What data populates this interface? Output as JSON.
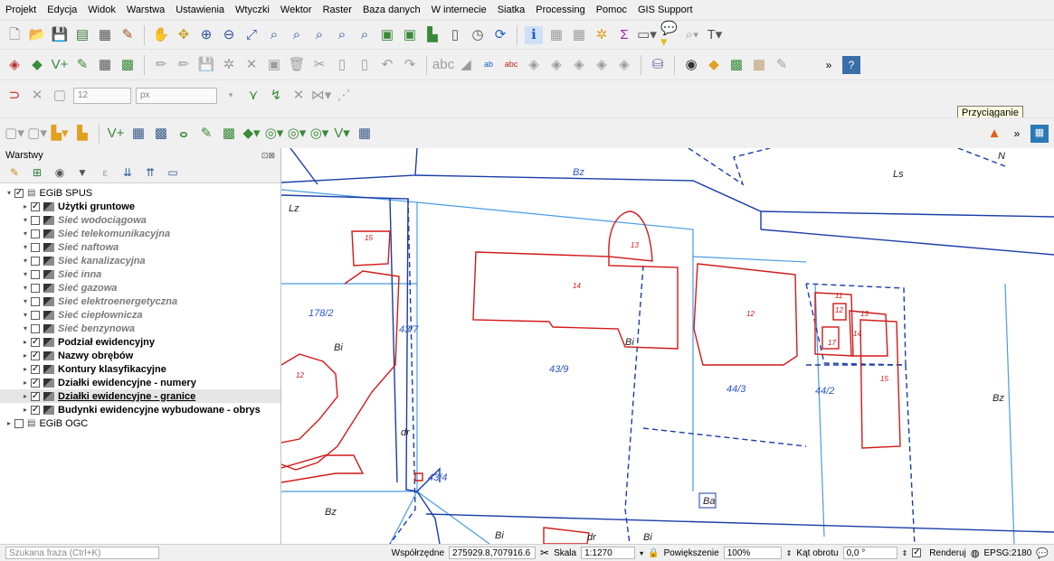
{
  "menu": [
    "Projekt",
    "Edycja",
    "Widok",
    "Warstwa",
    "Ustawienia",
    "Wtyczki",
    "Wektor",
    "Raster",
    "Baza danych",
    "W internecie",
    "Siatka",
    "Processing",
    "Pomoc",
    "GIS Support"
  ],
  "snapping": {
    "tolerance": "12",
    "unit": "px"
  },
  "tooltip": "Przyciąganie",
  "layers_panel": {
    "title": "Warstwy",
    "groups": [
      {
        "name": "EGiB SPUS",
        "checked": true,
        "expanded": true
      },
      {
        "name": "EGiB OGC",
        "checked": false,
        "expanded": false
      }
    ],
    "layers": [
      {
        "name": "Użytki gruntowe",
        "checked": true
      },
      {
        "name": "Sieć wodociągowa",
        "checked": false
      },
      {
        "name": "Sieć telekomunikacyjna",
        "checked": false
      },
      {
        "name": "Sieć naftowa",
        "checked": false
      },
      {
        "name": "Sieć kanalizacyjna",
        "checked": false
      },
      {
        "name": "Sieć inna",
        "checked": false
      },
      {
        "name": "Sieć gazowa",
        "checked": false
      },
      {
        "name": "Sieć elektroenergetyczna",
        "checked": false
      },
      {
        "name": "Sieć ciepłownicza",
        "checked": false
      },
      {
        "name": "Sieć benzynowa",
        "checked": false
      },
      {
        "name": "Podział ewidencyjny",
        "checked": true
      },
      {
        "name": "Nazwy obrębów",
        "checked": true
      },
      {
        "name": "Kontury klasyfikacyjne",
        "checked": true
      },
      {
        "name": "Działki ewidencyjne - numery",
        "checked": true
      },
      {
        "name": "Działki ewidencyjne - granice",
        "checked": true,
        "selected": true
      },
      {
        "name": "Budynki ewidencyjne wybudowane - obrys",
        "checked": true
      }
    ]
  },
  "map_labels": {
    "bz_top": "Bz",
    "lz": "Lz",
    "n": "N",
    "ls": "Ls",
    "p178": "178/2",
    "p43_7": "43/7",
    "bi_left": "Bi",
    "bi_mid": "Bi",
    "p43_9": "43/9",
    "p44_3": "44/3",
    "p44_2": "44/2",
    "bz_right": "Bz",
    "dr_left": "dr",
    "p43_4": "43/4",
    "ba": "Ba",
    "bz_bottom": "Bz",
    "bi_bottom": "Bi",
    "dr_bottom": "dr",
    "bi_bottom2": "Bi"
  },
  "building_labels": [
    "15",
    "13",
    "14",
    "12",
    "11",
    "12",
    "13",
    "14",
    "17",
    "15",
    "12"
  ],
  "status": {
    "search_placeholder": "Szukana fraza (Ctrl+K)",
    "coord_label": "Współrzędne",
    "coord_value": "275929.8,707916.6",
    "scale_label": "Skala",
    "scale_value": "1:1270",
    "magnifier_label": "Powiększenie",
    "magnifier_value": "100%",
    "rotation_label": "Kąt obrotu",
    "rotation_value": "0,0 °",
    "render_label": "Renderuj",
    "crs": "EPSG:2180"
  },
  "colors": {
    "parcel_line": "#1a3da8",
    "land_use_line": "#4a9be8",
    "building_line": "#d11a1a",
    "label_blue": "#2a55c8"
  }
}
